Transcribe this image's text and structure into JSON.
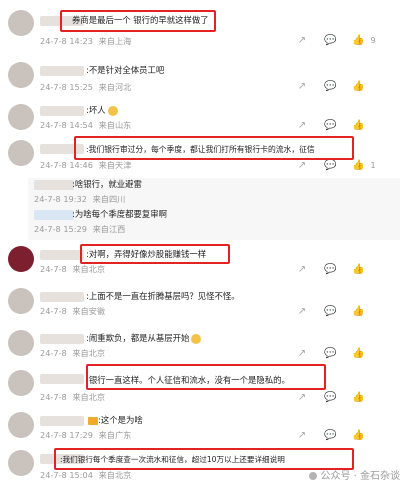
{
  "comments": [
    {
      "text": "券商是最后一个 银行的早就这样做了",
      "time": "24-7-8 14:23",
      "location": "来自上海",
      "likes": "9"
    },
    {
      "text": ":不是针对全体员工吧",
      "time": "24-7-8 15:25",
      "location": "来自河北"
    },
    {
      "text": ":坏人",
      "time": "24-7-8 14:54",
      "location": "来自山东"
    },
    {
      "text": ":我们银行审过分，每个季度，都让我们打所有银行卡的流水，征信",
      "time": "24-7-8 14:46",
      "location": "来自天津",
      "likes": "1",
      "replies": [
        {
          "text": ":啥银行，就业避雷",
          "time": "24-7-8 19:32",
          "location": "来自四川"
        },
        {
          "text": ":为啥每个季度都要复审啊",
          "time": "24-7-8 15:29",
          "location": "来自江西"
        }
      ]
    },
    {
      "text": ":对啊，弄得好像炒股能赚钱一样",
      "time": "24-7-8",
      "location": "来自北京"
    },
    {
      "text": ":上面不是一直在折腾基层吗？见怪不怪。",
      "time": "24-7-8",
      "location": "来自安徽"
    },
    {
      "text": ":闹重欺负，都是从基层开始",
      "time": "24-7-8",
      "location": "来自北京"
    },
    {
      "text": ":银行一直这样。个人征信和流水，没有一个是隐私的。",
      "time": "24-7-8",
      "location": "来自北京"
    },
    {
      "text": ":这个是为啥",
      "time": "24-7-8 17:29",
      "location": "来自广东"
    },
    {
      "text": ":我们银行每个季度查一次流水和征信，超过10万以上还要详细说明",
      "time": "24-7-8 15:04",
      "location": "来自北京"
    }
  ],
  "watermark": "公众号 · 金石杂谈",
  "icons": {
    "share": "share-icon",
    "comment": "comment-icon",
    "like": "like-icon"
  },
  "colors": {
    "highlight": "#e32222",
    "meta": "#9b9b9b"
  }
}
